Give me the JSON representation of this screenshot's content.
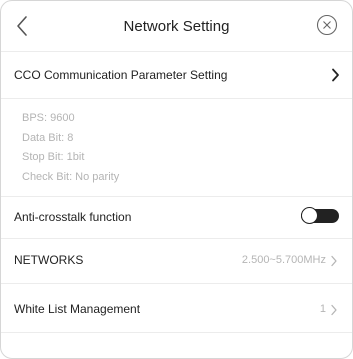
{
  "header": {
    "title": "Network Setting"
  },
  "cco": {
    "label": "CCO Communication Parameter Setting"
  },
  "params": [
    "BPS: 9600",
    "Data Bit: 8",
    "Stop Bit: 1bit",
    "Check Bit: No parity"
  ],
  "anti_crosstalk": {
    "label": "Anti-crosstalk function",
    "enabled": false
  },
  "networks": {
    "label": "NETWORKS",
    "value": "2.500~5.700MHz"
  },
  "white_list": {
    "label": "White List Management",
    "value": "1"
  },
  "colors": {
    "text": "#222222",
    "muted": "#b4b4b4",
    "divider": "#ececec",
    "toggle": "#222222"
  }
}
